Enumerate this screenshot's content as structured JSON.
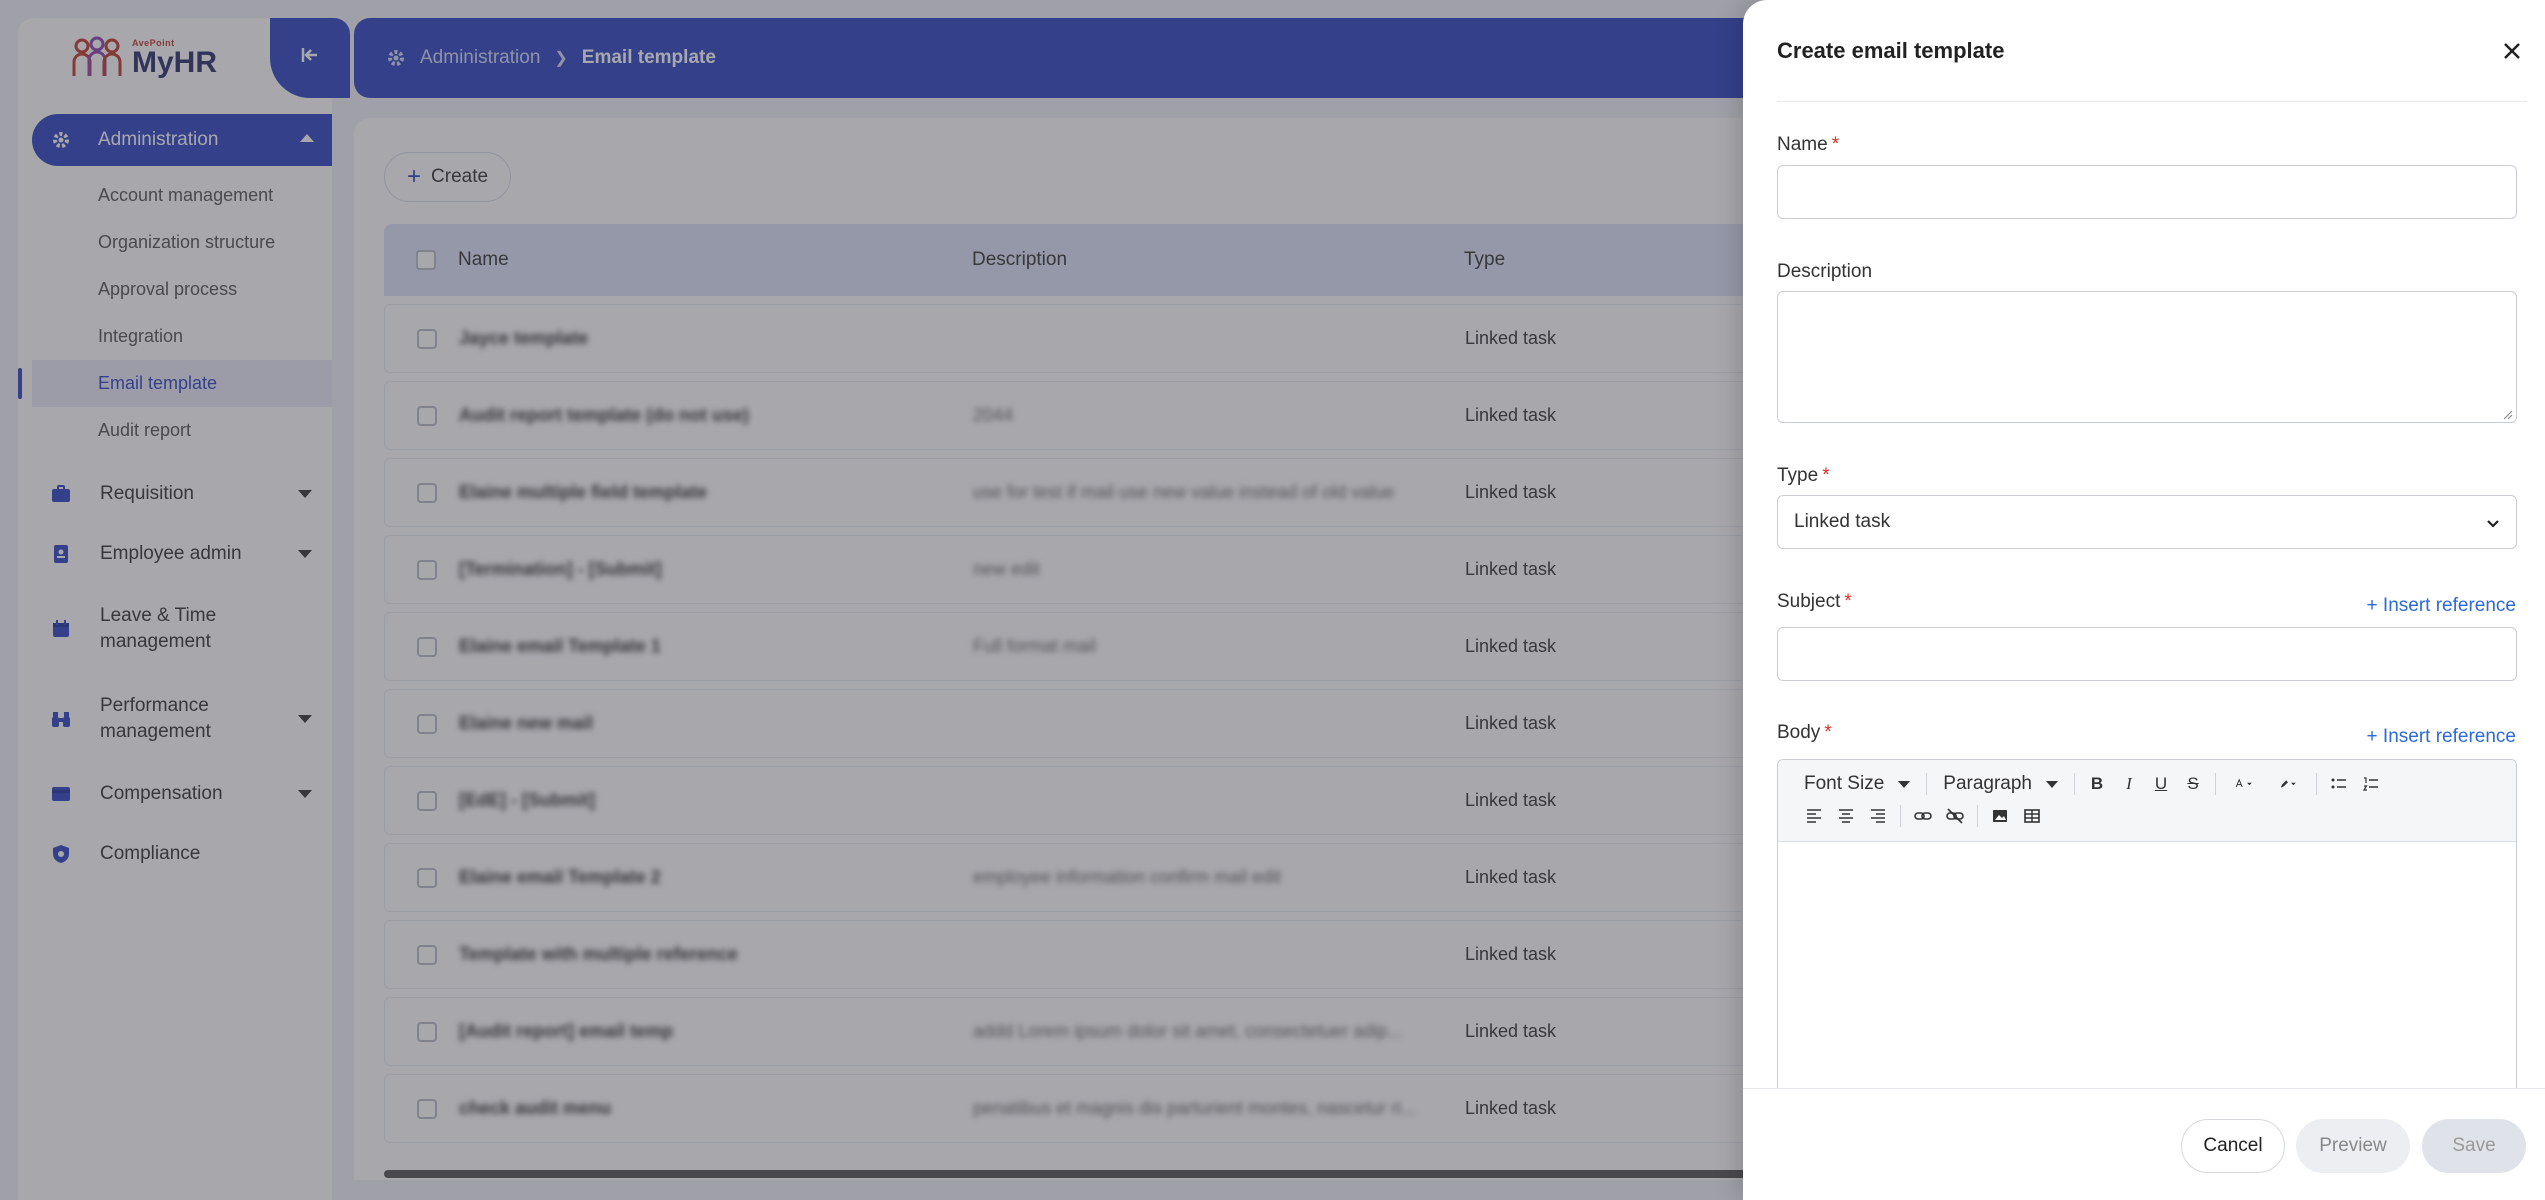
{
  "brand": {
    "logo_small": "AvePoint",
    "logo_text": "MyHR"
  },
  "sidebar": {
    "admin_label": "Administration",
    "sub_items": [
      {
        "label": "Account management"
      },
      {
        "label": "Organization structure"
      },
      {
        "label": "Approval process"
      },
      {
        "label": "Integration"
      },
      {
        "label": "Email template"
      },
      {
        "label": "Audit report"
      }
    ],
    "items": [
      {
        "label": "Requisition",
        "icon": "briefcase-icon"
      },
      {
        "label": "Employee admin",
        "icon": "id-badge-icon"
      },
      {
        "label": "Leave & Time management",
        "icon": "calendar-icon"
      },
      {
        "label": "Performance management",
        "icon": "binoculars-icon"
      },
      {
        "label": "Compensation",
        "icon": "wallet-icon"
      },
      {
        "label": "Compliance",
        "icon": "shield-gear-icon"
      }
    ]
  },
  "breadcrumb": {
    "root": "Administration",
    "current": "Email template"
  },
  "main": {
    "create_label": "Create",
    "columns": {
      "name": "Name",
      "description": "Description",
      "type": "Type"
    },
    "rows": [
      {
        "name": "Jayce template",
        "description": "",
        "type": "Linked task"
      },
      {
        "name": "Audit report template (do not use)",
        "description": "2044",
        "type": "Linked task"
      },
      {
        "name": "Elaine multiple field template",
        "description": "use for test if mail use new value instead of old value",
        "type": "Linked task"
      },
      {
        "name": "[Termination] - [Submit]",
        "description": "new edit",
        "type": "Linked task"
      },
      {
        "name": "Elaine email Template 1",
        "description": "Full format mail",
        "type": "Linked task"
      },
      {
        "name": "Elaine new mail",
        "description": "",
        "type": "Linked task"
      },
      {
        "name": "[EdE] - [Submit]",
        "description": "",
        "type": "Linked task"
      },
      {
        "name": "Elaine email Template 2",
        "description": "employee information confirm mail edit",
        "type": "Linked task"
      },
      {
        "name": "Template with multiple reference",
        "description": "",
        "type": "Linked task"
      },
      {
        "name": "[Audit report] email temp",
        "description": "addd Lorem ipsum dolor sit amet, consectetuer adip...",
        "type": "Linked task"
      },
      {
        "name": "check audit menu",
        "description": "penatibus et magnis dis parturient montes, nascetur ri...",
        "type": "Linked task"
      }
    ]
  },
  "panel": {
    "title": "Create email template",
    "name_label": "Name",
    "name_value": "",
    "description_label": "Description",
    "description_value": "",
    "type_label": "Type",
    "type_value": "Linked task",
    "subject_label": "Subject",
    "subject_value": "",
    "body_label": "Body",
    "required_mark": "*",
    "insert_reference": "+ Insert reference",
    "toolbar": {
      "font_size": "Font Size",
      "paragraph": "Paragraph"
    },
    "buttons": {
      "cancel": "Cancel",
      "preview": "Preview",
      "save": "Save"
    }
  },
  "colors": {
    "primary": "#2e46c2",
    "link": "#2e6ad6",
    "required": "#d93025"
  }
}
